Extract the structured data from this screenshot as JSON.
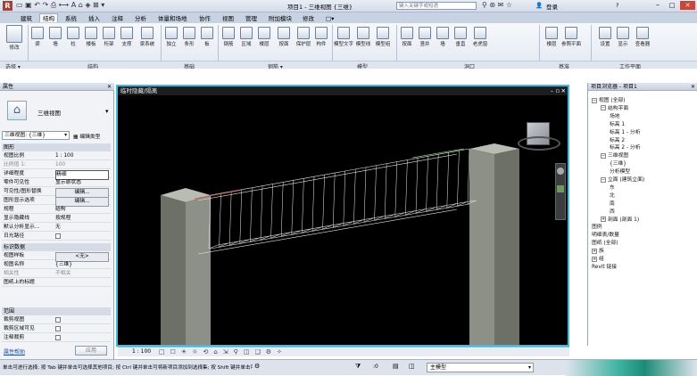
{
  "title_bar": {
    "title": "项目1 - 三维视图 {三维}",
    "search_placeholder": "键入关键字或短语",
    "login_label": "登录",
    "help_label": "?"
  },
  "menu_tabs": [
    "建筑",
    "结构",
    "系统",
    "插入",
    "注释",
    "分析",
    "体量和场地",
    "协作",
    "视图",
    "管理",
    "附加模块",
    "修改",
    "□▾"
  ],
  "active_tab_index": 1,
  "ribbon": {
    "buttons": [
      "修改",
      "梁",
      "墙",
      "柱",
      "楼板",
      "桁架",
      "支撑",
      "梁系统",
      "钢筋",
      "保护层",
      "梁",
      "墙",
      "独立",
      "条形",
      "板",
      "构件",
      "洞口",
      "竖井",
      "墙",
      "垂直",
      "老虎窗",
      "按面",
      "楼层",
      "区域",
      "模型文字",
      "模型线",
      "模型组",
      "参照平面",
      "设置",
      "显示",
      "查看器"
    ],
    "group_labels": [
      "选择 ▾",
      "结构",
      "基础",
      "钢筋 ▾",
      "模型",
      "洞口",
      "基准",
      "工作平面"
    ]
  },
  "properties": {
    "title": "属性",
    "type_name": "三维视图",
    "selector_value": "三维视图: {三维}",
    "edit_type_label": "编辑类型",
    "sections": [
      {
        "name": "图形",
        "rows": [
          [
            "视图比例",
            "1 : 100"
          ],
          [
            "比例值 1:",
            "100"
          ],
          [
            "详细程度",
            "精细"
          ],
          [
            "零件可见性",
            "显示原状态"
          ],
          [
            "可见性/图形替换",
            "编辑..."
          ],
          [
            "图形显示选项",
            "编辑..."
          ],
          [
            "规程",
            "结构"
          ],
          [
            "显示隐藏线",
            "按规程"
          ],
          [
            "默认分析显示...",
            "无"
          ],
          [
            "日光路径",
            ""
          ]
        ]
      },
      {
        "name": "标识数据",
        "rows": [
          [
            "视图样板",
            "<无>"
          ],
          [
            "视图名称",
            "{三维}"
          ],
          [
            "相关性",
            "不相关"
          ],
          [
            "图纸上的标题",
            ""
          ]
        ]
      },
      {
        "name": "范围",
        "rows": [
          [
            "裁剪视图",
            ""
          ],
          [
            "裁剪区域可见",
            ""
          ],
          [
            "注释裁剪",
            ""
          ]
        ]
      }
    ],
    "help_link": "属性帮助",
    "apply_label": "应用"
  },
  "view": {
    "title": "临时隐藏/隔离",
    "cube_label": "前"
  },
  "view_controls": {
    "scale": "1 : 100",
    "icons": [
      "□",
      "☐",
      "☀",
      "☼",
      "⟲",
      "⌂",
      "⇲",
      "⚲",
      "◫",
      "❑",
      "⚙",
      "✧"
    ]
  },
  "project_browser": {
    "title": "项目浏览器 - 项目1",
    "items": [
      {
        "text": "视图 (全部)",
        "level": 0,
        "toggle": "−"
      },
      {
        "text": "结构平面",
        "level": 1,
        "toggle": "−"
      },
      {
        "text": "场地",
        "level": 2
      },
      {
        "text": "标高 1",
        "level": 2
      },
      {
        "text": "标高 1 - 分析",
        "level": 2
      },
      {
        "text": "标高 2",
        "level": 2
      },
      {
        "text": "标高 2 - 分析",
        "level": 2
      },
      {
        "text": "三维视图",
        "level": 1,
        "toggle": "−"
      },
      {
        "text": "{三维}",
        "level": 2
      },
      {
        "text": "分析模型",
        "level": 2
      },
      {
        "text": "立面 (建筑立面)",
        "level": 1,
        "toggle": "−"
      },
      {
        "text": "东",
        "level": 2
      },
      {
        "text": "北",
        "level": 2
      },
      {
        "text": "南",
        "level": 2
      },
      {
        "text": "西",
        "level": 2
      },
      {
        "text": "剖面 (剖面 1)",
        "level": 1,
        "toggle": "+"
      },
      {
        "text": "图例",
        "level": 0
      },
      {
        "text": "明细表/数量",
        "level": 0
      },
      {
        "text": "图纸 (全部)",
        "level": 0
      },
      {
        "text": "族",
        "level": 0,
        "toggle": "+"
      },
      {
        "text": "组",
        "level": 0,
        "toggle": "+"
      },
      {
        "text": "Revit 链接",
        "level": 0
      }
    ]
  },
  "status_bar": {
    "message": "单击可进行选择; 按 Tab 键并单击可选择其他项目; 按 Ctrl 键并单击可将新项目添加到选择集; 按 Shift 键并单击可取消选择。",
    "zero": ":0",
    "model_label": "主模型"
  },
  "colors": {
    "view_border": "#35c1e6",
    "ribbon_bg": "#eef1f6",
    "chrome_blue": "#c7d2e3"
  }
}
